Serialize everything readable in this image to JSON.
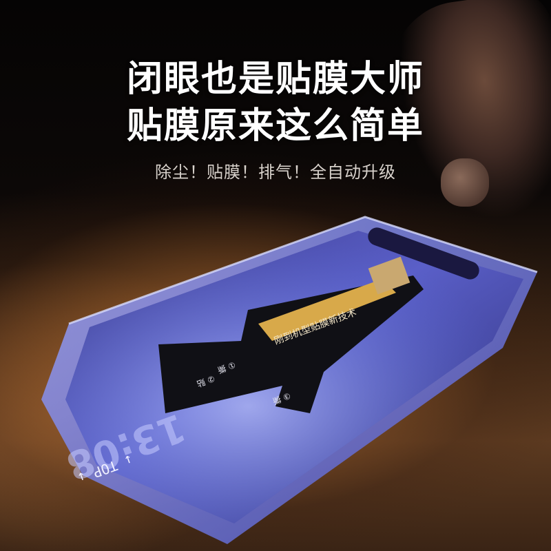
{
  "headline": {
    "line1": "闭眼也是贴膜大师",
    "line2": "贴膜原来这么简单"
  },
  "subtitle": "除尘！贴膜！排气！全自动升级",
  "tray": {
    "top_mark": "↓ TOP ↓",
    "clock": "13:08",
    "strip_text": "刚到机型贴膜新技术",
    "steps": [
      "① 撕",
      "② 贴",
      "③ 撕"
    ]
  },
  "colors": {
    "accent_blue": "#5a6fe0",
    "glow_orange": "#d6964f"
  }
}
